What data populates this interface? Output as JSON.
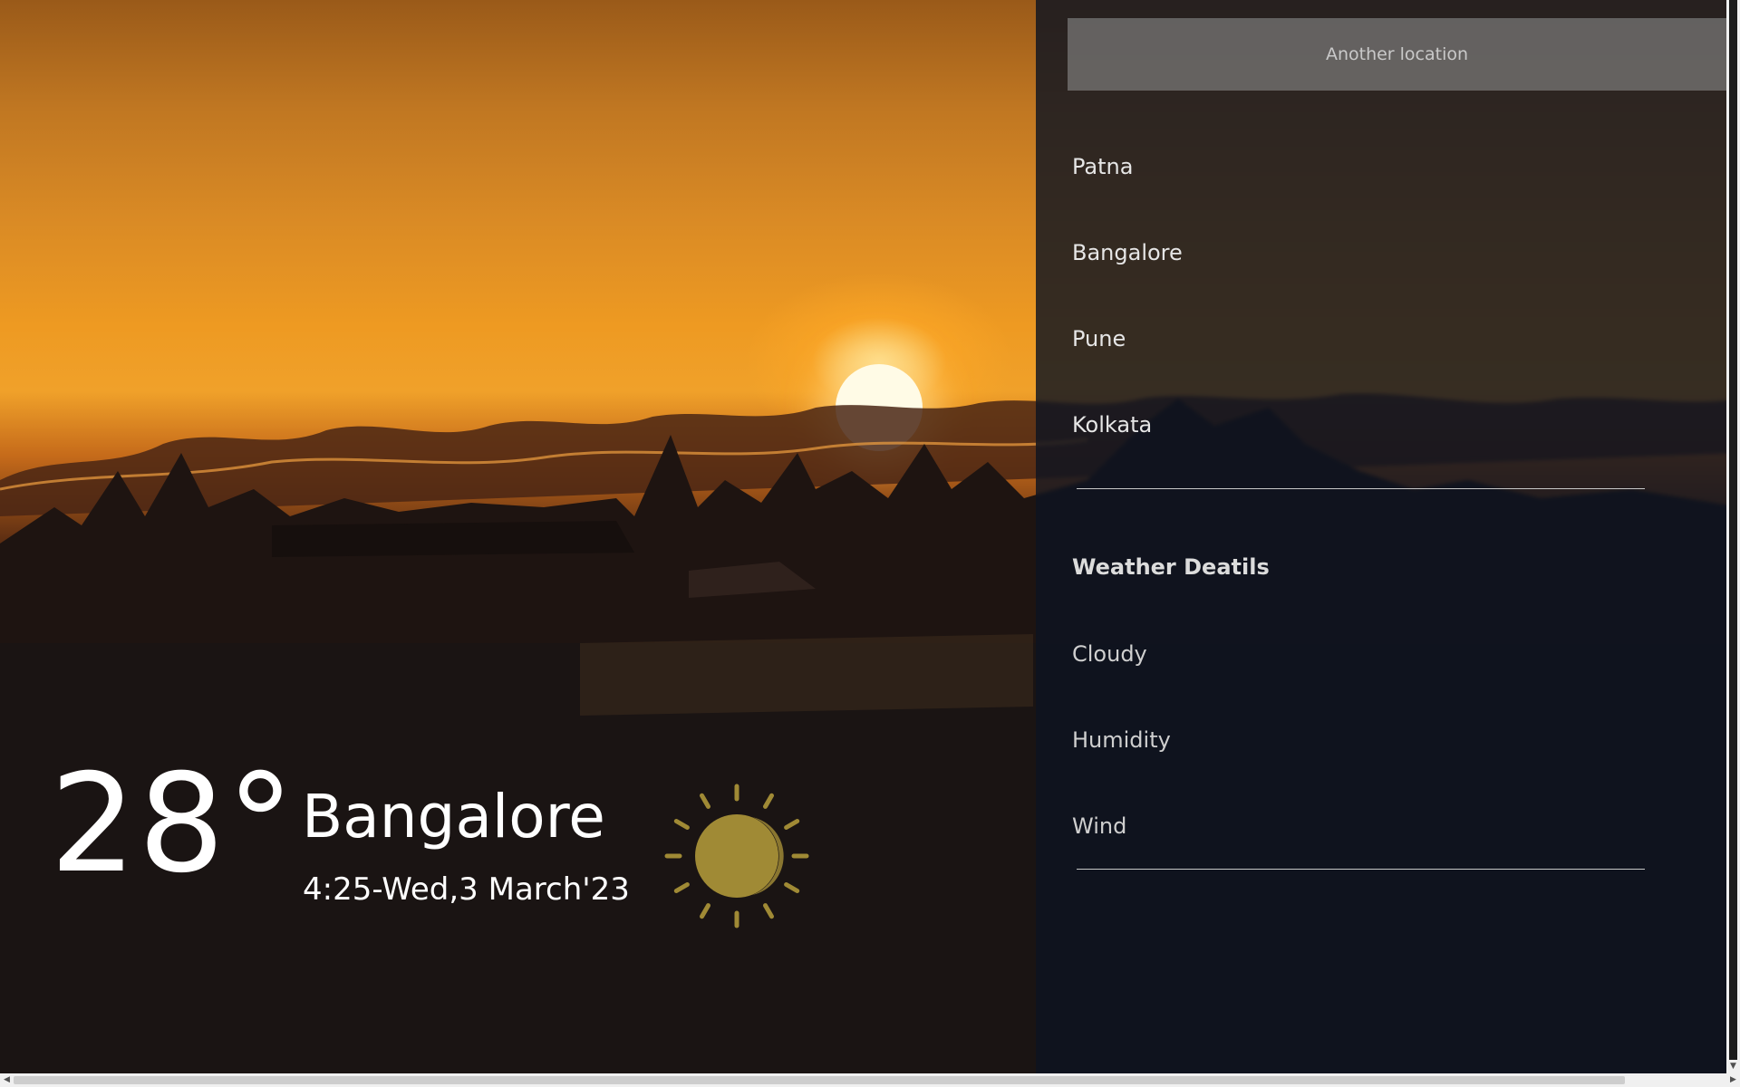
{
  "search": {
    "placeholder": "Another location"
  },
  "locations": [
    {
      "label": "Patna"
    },
    {
      "label": "Bangalore"
    },
    {
      "label": "Pune"
    },
    {
      "label": "Kolkata"
    }
  ],
  "details": {
    "title": "Weather Deatils",
    "items": [
      {
        "label": "Cloudy"
      },
      {
        "label": "Humidity"
      },
      {
        "label": "Wind"
      }
    ]
  },
  "weather": {
    "temperature": "28°",
    "city": "Bangalore",
    "datetime": "4:25-Wed,3 March'23",
    "icon": "sun-icon"
  },
  "colors": {
    "sun_icon": "#a08a35",
    "panel": "#0e1421"
  }
}
